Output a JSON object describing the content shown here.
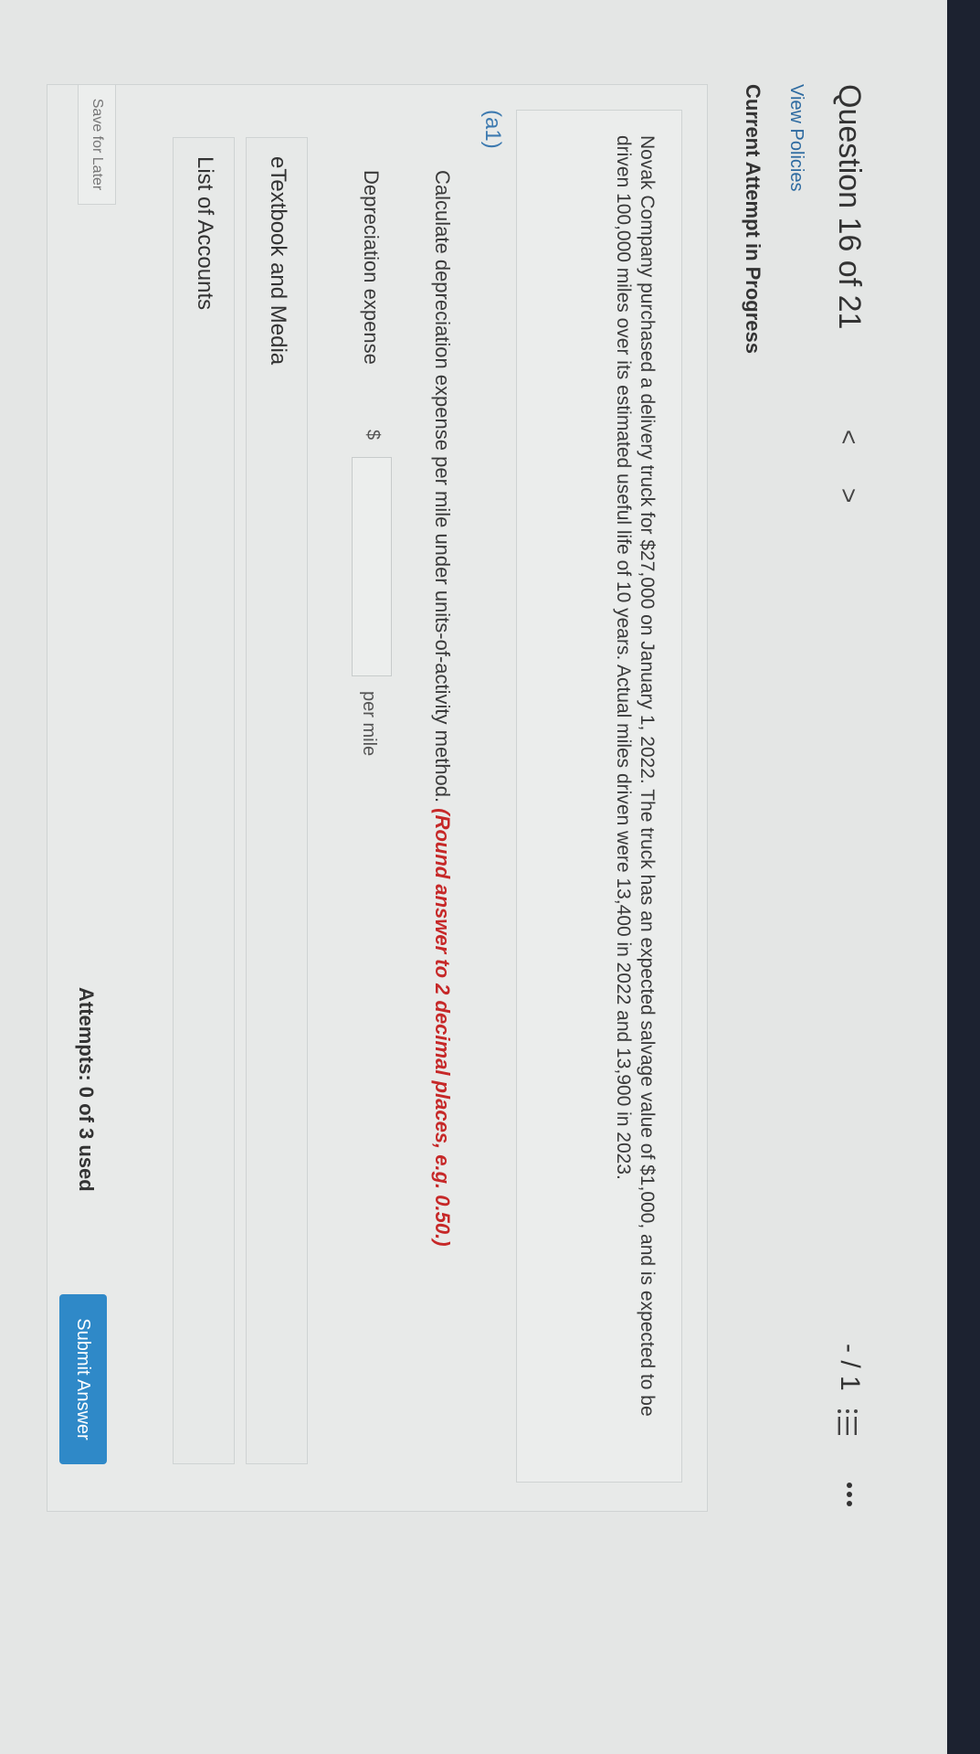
{
  "header": {
    "question_label": "Question 16 of 21",
    "prev_icon": "<",
    "next_icon": ">",
    "score": "- / 1",
    "list_icon": "list-icon",
    "more_icon": "more-icon"
  },
  "links": {
    "view_policies": "View Policies"
  },
  "status": {
    "attempt_status": "Current Attempt in Progress"
  },
  "problem": {
    "text": "Novak Company purchased a delivery truck for $27,000 on January 1, 2022. The truck has an expected salvage value of $1,000, and is expected to be driven 100,000 miles over its estimated useful life of 10 years. Actual miles driven were 13,400 in 2022 and 13,900 in 2023."
  },
  "part": {
    "label": "(a1)",
    "instruction_main": "Calculate depreciation expense per mile under units-of-activity method.",
    "instruction_hint": "(Round answer to 2 decimal places, e.g. 0.50.)",
    "field_label": "Depreciation expense",
    "currency": "$",
    "field_value": "",
    "unit": "per mile"
  },
  "panels": {
    "etextbook": "eTextbook and Media",
    "accounts": "List of Accounts"
  },
  "footer": {
    "save_label": "Save for Later",
    "attempts": "Attempts: 0 of 3 used",
    "submit_label": "Submit Answer"
  },
  "colors": {
    "accent": "#2f89c8",
    "hint_red": "#c62828",
    "link_blue": "#2d6aa0"
  }
}
